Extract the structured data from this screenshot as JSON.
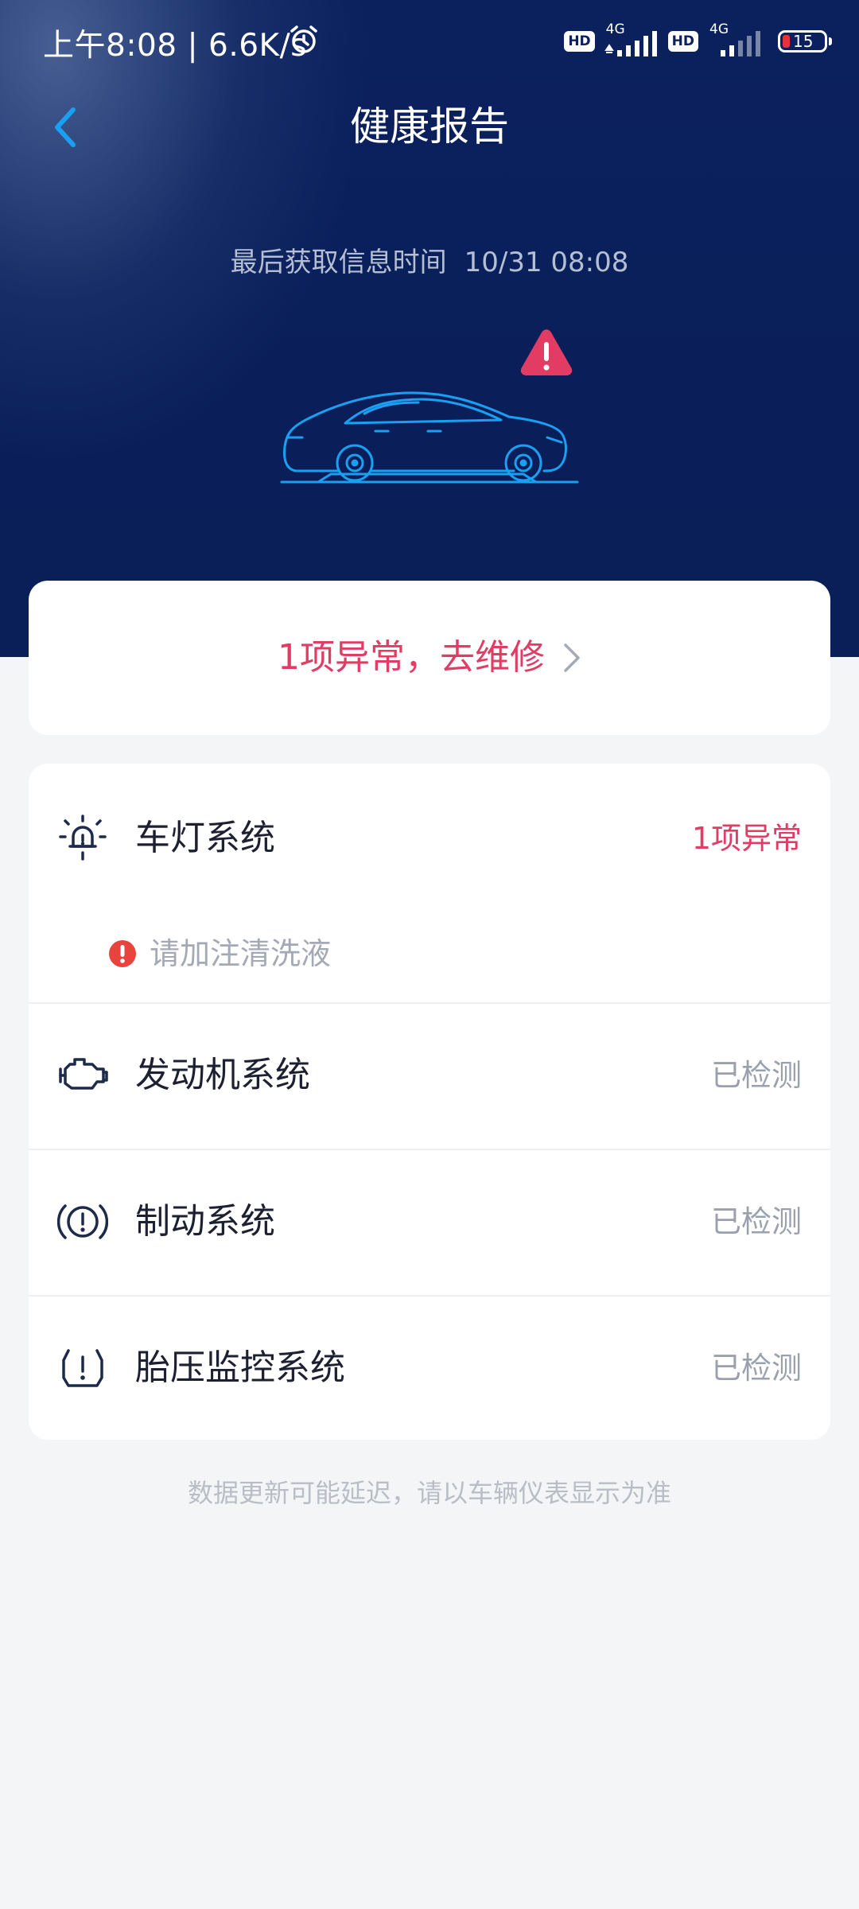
{
  "status_bar": {
    "time_speed": "上午8:08 | 6.6K/s",
    "alarm_icon": "alarm-clock-icon",
    "sim1_badge": "HD",
    "sim1_network": "4G",
    "sim2_badge": "HD",
    "sim2_network": "4G",
    "battery_level": "15"
  },
  "header": {
    "back_icon": "chevron-left-icon",
    "title": "健康报告"
  },
  "info": {
    "last_fetch_label": "最后获取信息时间",
    "last_fetch_time": "10/31 08:08"
  },
  "hero": {
    "car_icon": "car-outline-icon",
    "warning_icon": "warning-triangle-icon"
  },
  "repair_card": {
    "text": "1项异常，去维修",
    "chevron_icon": "chevron-right-icon"
  },
  "systems": [
    {
      "icon": "lamp-icon",
      "name": "车灯系统",
      "status": "1项异常",
      "issues": [
        "请加注清洗液"
      ]
    },
    {
      "icon": "engine-icon",
      "name": "发动机系统",
      "status": "已检测"
    },
    {
      "icon": "brake-icon",
      "name": "制动系统",
      "status": "已检测"
    },
    {
      "icon": "tire-pressure-icon",
      "name": "胎压监控系统",
      "status": "已检测"
    }
  ],
  "footer": {
    "note": "数据更新可能延迟，请以车辆仪表显示为准"
  },
  "colors": {
    "header_bg": "#0b215e",
    "accent_blue": "#1aa0f0",
    "alert_red": "#e23c65",
    "page_bg": "#f4f5f7"
  }
}
